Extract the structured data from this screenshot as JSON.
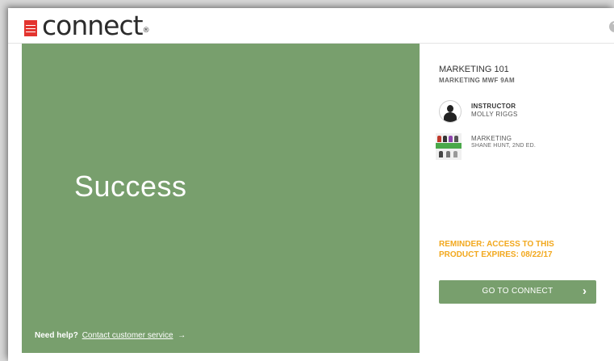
{
  "header": {
    "logo_text": "connect",
    "logo_mark": "®",
    "brand_box_lines": [
      "Mc",
      "Graw",
      "Hill",
      "Education"
    ],
    "help_icon": "question-circle-icon",
    "help_glyph": "?"
  },
  "hero": {
    "title": "Success",
    "background_color": "#789f6d",
    "help_prefix": "Need help?",
    "help_link": "Contact customer service",
    "help_arrow": "→"
  },
  "course": {
    "name": "MARKETING 101",
    "section": "MARKETING MWF 9AM"
  },
  "instructor": {
    "label": "INSTRUCTOR",
    "name": "MOLLY RIGGS"
  },
  "book": {
    "title": "MARKETING",
    "author": "SHANE HUNT, 2ND ED."
  },
  "reminder": {
    "line1": "REMINDER: ACCESS TO THIS",
    "line2": "PRODUCT EXPIRES: 08/22/17",
    "color": "#f2a81d"
  },
  "cta": {
    "label": "GO TO CONNECT",
    "chevron": "›"
  }
}
